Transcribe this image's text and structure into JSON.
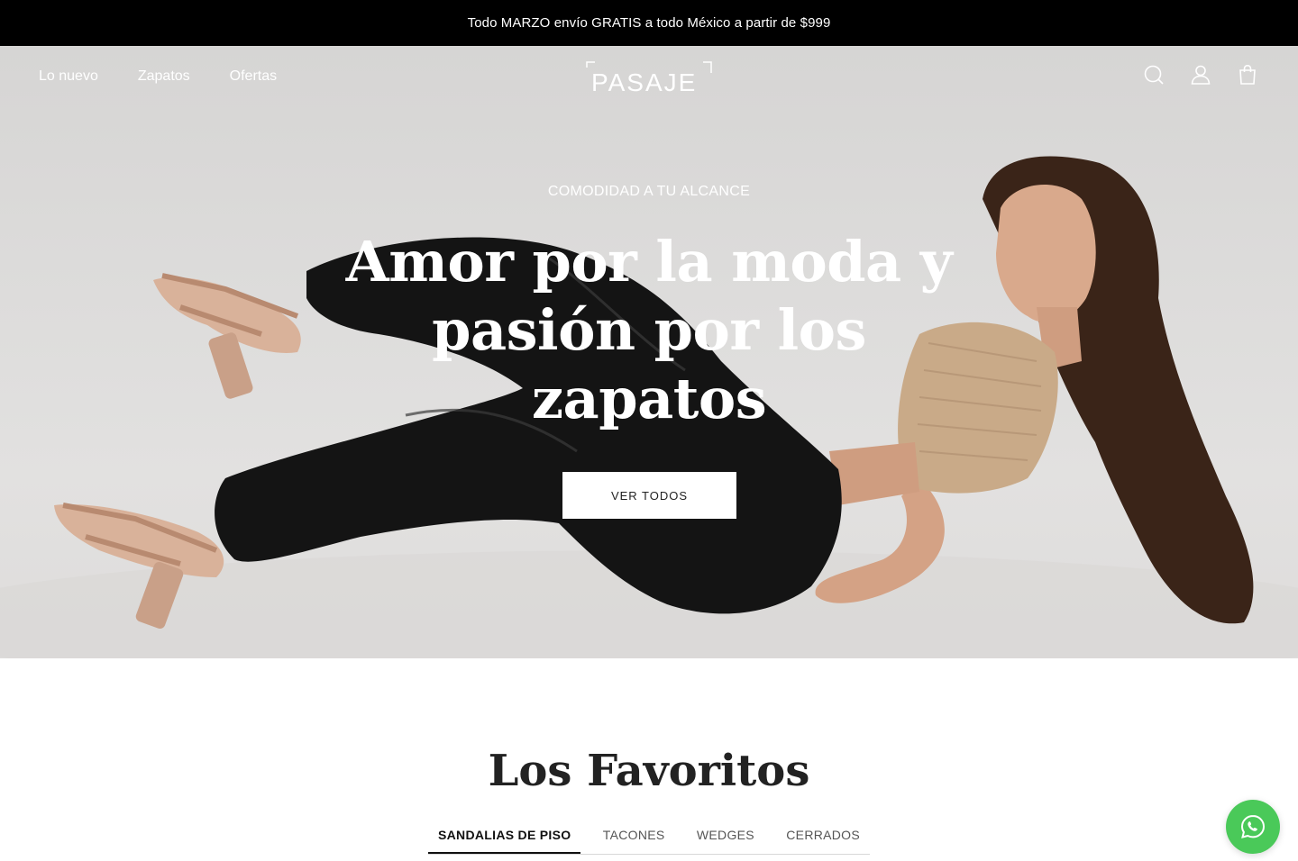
{
  "announcement": {
    "text": "Todo MARZO envío GRATIS a todo México a partir de $999"
  },
  "header": {
    "nav": [
      {
        "label": "Lo nuevo"
      },
      {
        "label": "Zapatos"
      },
      {
        "label": "Ofertas"
      }
    ],
    "logo_text": "PASAJE",
    "icons": [
      "search-icon",
      "account-icon",
      "cart-icon"
    ]
  },
  "hero": {
    "subtitle": "COMODIDAD A TU ALCANCE",
    "title": "Amor por la moda y pasión por los zapatos",
    "button_label": "VER TODOS"
  },
  "favorites": {
    "title": "Los Favoritos",
    "tabs": [
      {
        "label": "SANDALIAS DE PISO",
        "active": true
      },
      {
        "label": "TACONES",
        "active": false
      },
      {
        "label": "WEDGES",
        "active": false
      },
      {
        "label": "CERRADOS",
        "active": false
      }
    ]
  },
  "floating": {
    "icon": "whatsapp-icon"
  },
  "colors": {
    "announce_bg": "#000000",
    "whatsapp": "#4ac959",
    "text": "#222222"
  }
}
